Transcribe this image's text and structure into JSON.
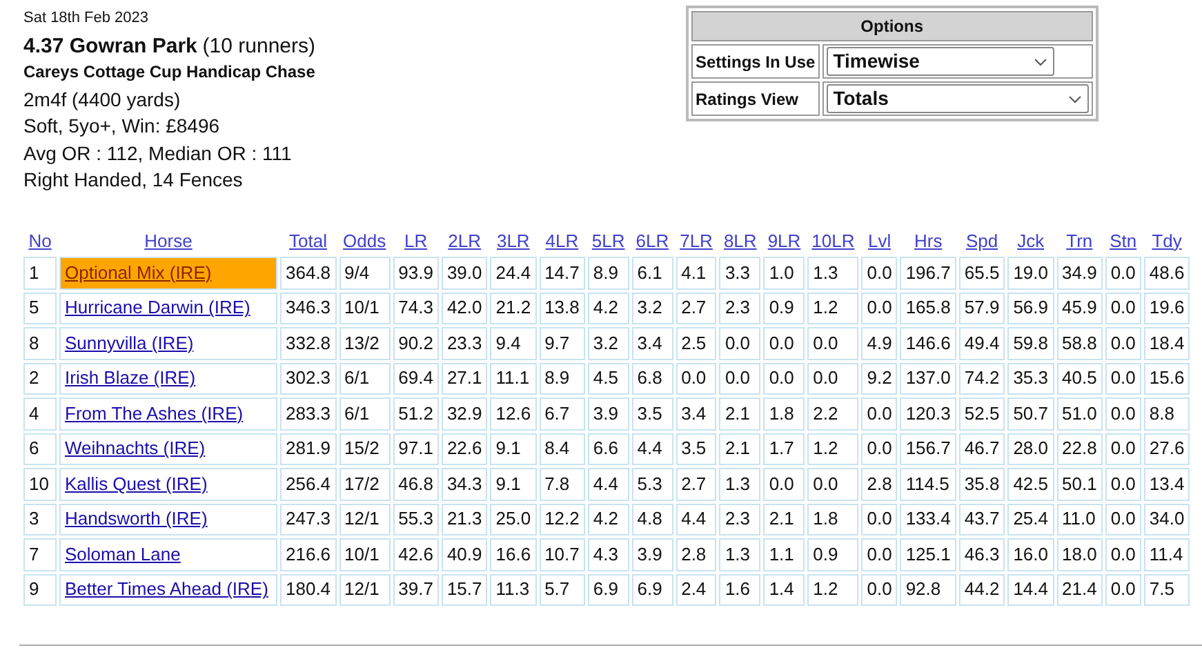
{
  "race": {
    "date": "Sat 18th Feb 2023",
    "time_course": "4.37 Gowran Park",
    "runners": "(10 runners)",
    "name": "Careys Cottage Cup Handicap Chase",
    "distance": "2m4f (4400 yards)",
    "conditions": "Soft, 5yo+, Win: £8496",
    "ratings": "Avg OR : 112, Median OR : 111",
    "track": "Right Handed, 14 Fences"
  },
  "options": {
    "title": "Options",
    "rows": [
      {
        "label": "Settings In Use",
        "value": "Timewise"
      },
      {
        "label": "Ratings View",
        "value": "Totals"
      }
    ]
  },
  "table": {
    "columns": [
      "No",
      "Horse",
      "Total",
      "Odds",
      "LR",
      "2LR",
      "3LR",
      "4LR",
      "5LR",
      "6LR",
      "7LR",
      "8LR",
      "9LR",
      "10LR",
      "Lvl",
      "Hrs",
      "Spd",
      "Jck",
      "Trn",
      "Stn",
      "Tdy"
    ],
    "rows": [
      {
        "no": "1",
        "horse": "Optional Mix (IRE)",
        "selected": true,
        "values": [
          "364.8",
          "9/4",
          "93.9",
          "39.0",
          "24.4",
          "14.7",
          "8.9",
          "6.1",
          "4.1",
          "3.3",
          "1.0",
          "1.3",
          "0.0",
          "196.7",
          "65.5",
          "19.0",
          "34.9",
          "0.0",
          "48.6"
        ]
      },
      {
        "no": "5",
        "horse": "Hurricane Darwin (IRE)",
        "selected": false,
        "values": [
          "346.3",
          "10/1",
          "74.3",
          "42.0",
          "21.2",
          "13.8",
          "4.2",
          "3.2",
          "2.7",
          "2.3",
          "0.9",
          "1.2",
          "0.0",
          "165.8",
          "57.9",
          "56.9",
          "45.9",
          "0.0",
          "19.6"
        ]
      },
      {
        "no": "8",
        "horse": "Sunnyvilla (IRE)",
        "selected": false,
        "values": [
          "332.8",
          "13/2",
          "90.2",
          "23.3",
          "9.4",
          "9.7",
          "3.2",
          "3.4",
          "2.5",
          "0.0",
          "0.0",
          "0.0",
          "4.9",
          "146.6",
          "49.4",
          "59.8",
          "58.8",
          "0.0",
          "18.4"
        ]
      },
      {
        "no": "2",
        "horse": "Irish Blaze (IRE)",
        "selected": false,
        "values": [
          "302.3",
          "6/1",
          "69.4",
          "27.1",
          "11.1",
          "8.9",
          "4.5",
          "6.8",
          "0.0",
          "0.0",
          "0.0",
          "0.0",
          "9.2",
          "137.0",
          "74.2",
          "35.3",
          "40.5",
          "0.0",
          "15.6"
        ]
      },
      {
        "no": "4",
        "horse": "From The Ashes (IRE)",
        "selected": false,
        "values": [
          "283.3",
          "6/1",
          "51.2",
          "32.9",
          "12.6",
          "6.7",
          "3.9",
          "3.5",
          "3.4",
          "2.1",
          "1.8",
          "2.2",
          "0.0",
          "120.3",
          "52.5",
          "50.7",
          "51.0",
          "0.0",
          "8.8"
        ]
      },
      {
        "no": "6",
        "horse": "Weihnachts (IRE)",
        "selected": false,
        "values": [
          "281.9",
          "15/2",
          "97.1",
          "22.6",
          "9.1",
          "8.4",
          "6.6",
          "4.4",
          "3.5",
          "2.1",
          "1.7",
          "1.2",
          "0.0",
          "156.7",
          "46.7",
          "28.0",
          "22.8",
          "0.0",
          "27.6"
        ]
      },
      {
        "no": "10",
        "horse": "Kallis Quest (IRE)",
        "selected": false,
        "values": [
          "256.4",
          "17/2",
          "46.8",
          "34.3",
          "9.1",
          "7.8",
          "4.4",
          "5.3",
          "2.7",
          "1.3",
          "0.0",
          "0.0",
          "2.8",
          "114.5",
          "35.8",
          "42.5",
          "50.1",
          "0.0",
          "13.4"
        ]
      },
      {
        "no": "3",
        "horse": "Handsworth (IRE)",
        "selected": false,
        "values": [
          "247.3",
          "12/1",
          "55.3",
          "21.3",
          "25.0",
          "12.2",
          "4.2",
          "4.8",
          "4.4",
          "2.3",
          "2.1",
          "1.8",
          "0.0",
          "133.4",
          "43.7",
          "25.4",
          "11.0",
          "0.0",
          "34.0"
        ]
      },
      {
        "no": "7",
        "horse": "Soloman Lane",
        "selected": false,
        "values": [
          "216.6",
          "10/1",
          "42.6",
          "40.9",
          "16.6",
          "10.7",
          "4.3",
          "3.9",
          "2.8",
          "1.3",
          "1.1",
          "0.9",
          "0.0",
          "125.1",
          "46.3",
          "16.0",
          "18.0",
          "0.0",
          "11.4"
        ]
      },
      {
        "no": "9",
        "horse": "Better Times Ahead (IRE)",
        "selected": false,
        "values": [
          "180.4",
          "12/1",
          "39.7",
          "15.7",
          "11.3",
          "5.7",
          "6.9",
          "6.9",
          "2.4",
          "1.6",
          "1.4",
          "1.2",
          "0.0",
          "92.8",
          "44.2",
          "14.4",
          "21.4",
          "0.0",
          "7.5"
        ]
      }
    ]
  }
}
